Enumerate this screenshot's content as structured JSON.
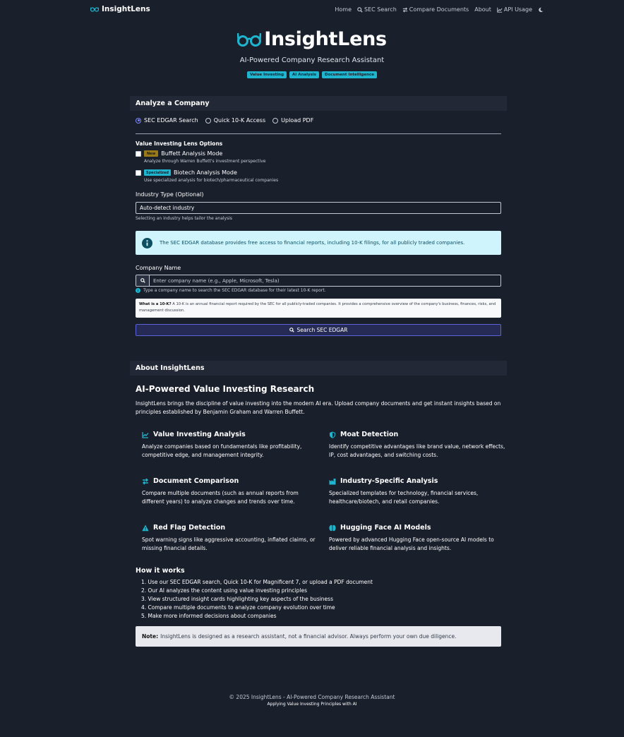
{
  "nav": {
    "brand": "InsightLens",
    "links": [
      {
        "label": "Home",
        "icon": "none"
      },
      {
        "label": "SEC Search",
        "icon": "search-icon"
      },
      {
        "label": "Compare Documents",
        "icon": "exchange-icon"
      },
      {
        "label": "About",
        "icon": "none"
      },
      {
        "label": "API Usage",
        "icon": "chart-line-icon"
      }
    ],
    "theme_toggle_icon": "moon-icon"
  },
  "hero": {
    "title": "InsightLens",
    "subtitle": "AI-Powered Company Research Assistant",
    "badges": [
      "Value Investing",
      "AI Analysis",
      "Document Intelligence"
    ]
  },
  "analyze": {
    "header": "Analyze a Company",
    "radios": [
      {
        "label": "SEC EDGAR Search",
        "checked": true
      },
      {
        "label": "Quick 10-K Access",
        "checked": false
      },
      {
        "label": "Upload PDF",
        "checked": false
      }
    ],
    "lens_title": "Value Investing Lens Options",
    "buffett": {
      "tag": "New",
      "label": "Buffett Analysis Mode",
      "hint": "Analyze through Warren Buffett's investment perspective"
    },
    "biotech": {
      "tag": "Specialized",
      "label": "Biotech Analysis Mode",
      "hint": "Use specialized analysis for biotech/pharmaceutical companies"
    },
    "industry_label": "Industry Type (Optional)",
    "industry_value": "Auto-detect industry",
    "industry_hint": "Selecting an industry helps tailor the analysis",
    "info_text": "The SEC EDGAR database provides free access to financial reports, including 10-K filings, for all publicly traded companies.",
    "company_label": "Company Name",
    "company_placeholder": "Enter company name (e.g., Apple, Microsoft, Tesla)",
    "company_hint": "Type a company name to search the SEC EDGAR database for their latest 10-K report.",
    "what_title": "What is a 10-K?",
    "what_text": "A 10-K is an annual financial report required by the SEC for all publicly-traded companies. It provides a comprehensive overview of the company's business, finances, risks, and management discussion.",
    "search_button": "Search SEC EDGAR"
  },
  "about": {
    "header": "About InsightLens",
    "title": "AI-Powered Value Investing Research",
    "intro": "InsightLens brings the discipline of value investing into the modern AI era. Upload company documents and get instant insights based on principles established by Benjamin Graham and Warren Buffett.",
    "features": [
      {
        "title": "Value Investing Analysis",
        "icon": "chart-line-icon",
        "text": "Analyze companies based on fundamentals like profitability, competitive edge, and management integrity."
      },
      {
        "title": "Moat Detection",
        "icon": "shield-icon",
        "text": "Identify competitive advantages like brand value, network effects, IP, cost advantages, and switching costs."
      },
      {
        "title": "Document Comparison",
        "icon": "exchange-icon",
        "text": "Compare multiple documents (such as annual reports from different years) to analyze changes and trends over time."
      },
      {
        "title": "Industry-Specific Analysis",
        "icon": "industry-icon",
        "text": "Specialized templates for technology, financial services, healthcare/biotech, and retail companies."
      },
      {
        "title": "Red Flag Detection",
        "icon": "warning-icon",
        "text": "Spot warning signs like aggressive accounting, inflated claims, or missing financial details."
      },
      {
        "title": "Hugging Face AI Models",
        "icon": "brain-icon",
        "text": "Powered by advanced Hugging Face open-source AI models to deliver reliable financial analysis and insights."
      }
    ],
    "how_title": "How it works",
    "how_steps": [
      "1. Use our SEC EDGAR search, Quick 10-K for Magnificent 7, or upload a PDF document",
      "2. Our AI analyzes the content using value investing principles",
      "3. View structured insight cards highlighting key aspects of the business",
      "4. Compare multiple documents to analyze company evolution over time",
      "5. Make more informed decisions about companies"
    ],
    "note_label": "Note:",
    "note_text": "InsightLens is designed as a research assistant, not a financial advisor. Always perform your own due diligence."
  },
  "footer": {
    "line1": "© 2025 InsightLens - AI-Powered Company Research Assistant",
    "line2": "Applying Value Investing Principles with AI"
  },
  "colors": {
    "background": "#1a1f2c",
    "accent": "#1fb5cf",
    "card_header": "#232836",
    "button_border": "#5b63d6"
  }
}
